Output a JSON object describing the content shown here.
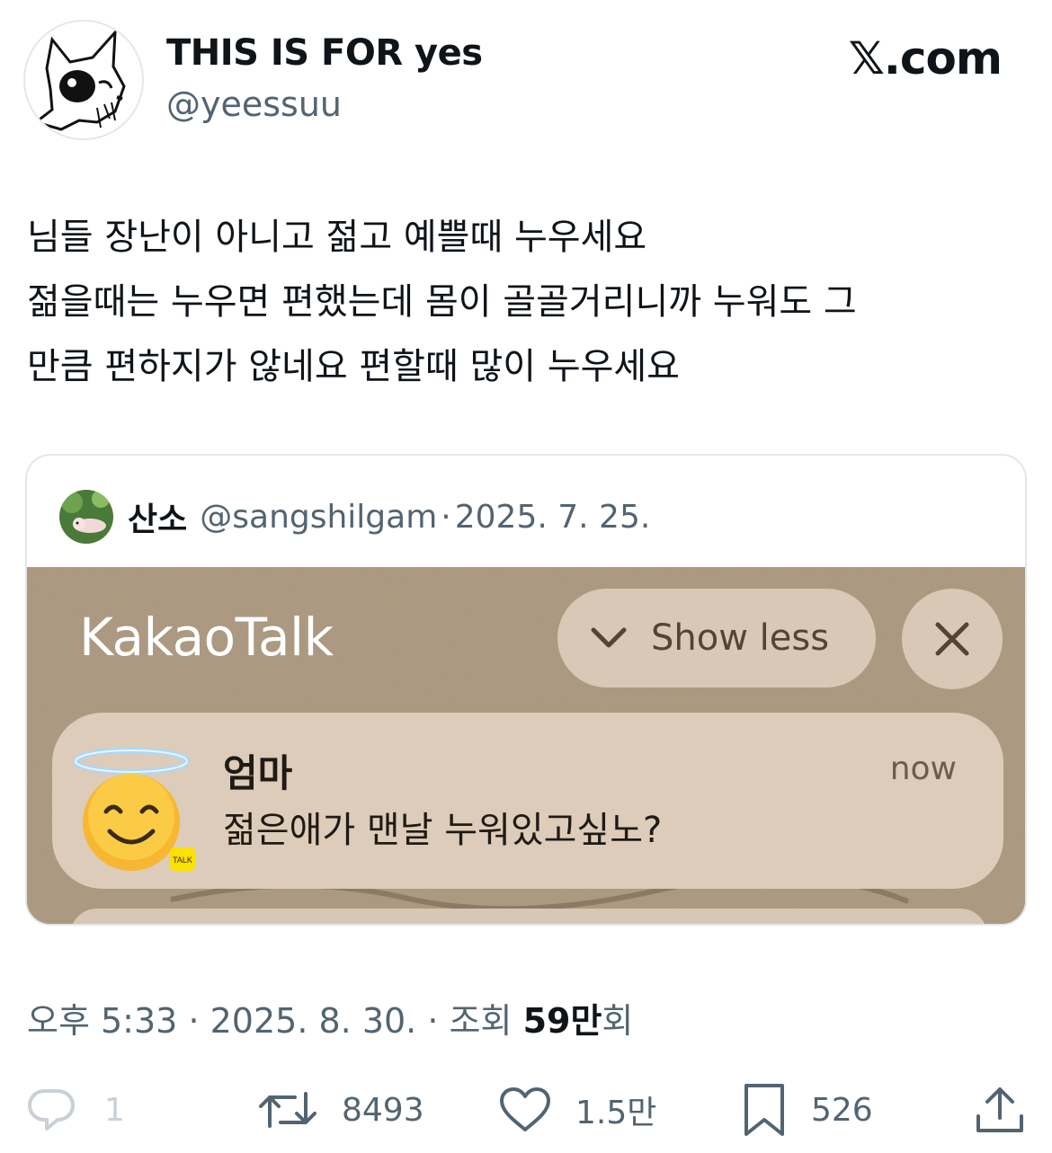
{
  "author": {
    "display_name": "THIS IS FOR yes",
    "handle": "@yeessuu",
    "avatar_icon": "dog-sketch-avatar"
  },
  "site_logo": "𝕏.com",
  "tweet_lines": [
    "님들 장난이 아니고 젊고 예쁠때 누우세요",
    "젊을때는 누우면 편했는데 몸이 골골거리니까 누워도 그",
    "만큼 편하지가 않네요 편할때 많이 누우세요"
  ],
  "quote": {
    "name": "산소",
    "handle": "@sangshilgam",
    "dot": "·",
    "date": "2025. 7. 25.",
    "media": {
      "app_title": "KakaoTalk",
      "show_less": "Show less",
      "notification": {
        "sender": "엄마",
        "message": "젊은애가 맨날 누워있고싶노?",
        "time": "now",
        "emoji_icon": "smiling-face-with-halo-icon"
      }
    }
  },
  "meta": {
    "time": "오후 5:33",
    "sep1": "·",
    "date": "2025. 8. 30.",
    "sep2": "·",
    "views_label": "조회",
    "views_value": "59만",
    "views_suffix": "회"
  },
  "actions": {
    "replies": "1",
    "retweets": "8493",
    "likes": "1.5만",
    "bookmarks": "526"
  },
  "colors": {
    "text": "#0f1419",
    "secondary": "#536471",
    "sand": "#a79278",
    "pill": "#d9c8b5"
  }
}
